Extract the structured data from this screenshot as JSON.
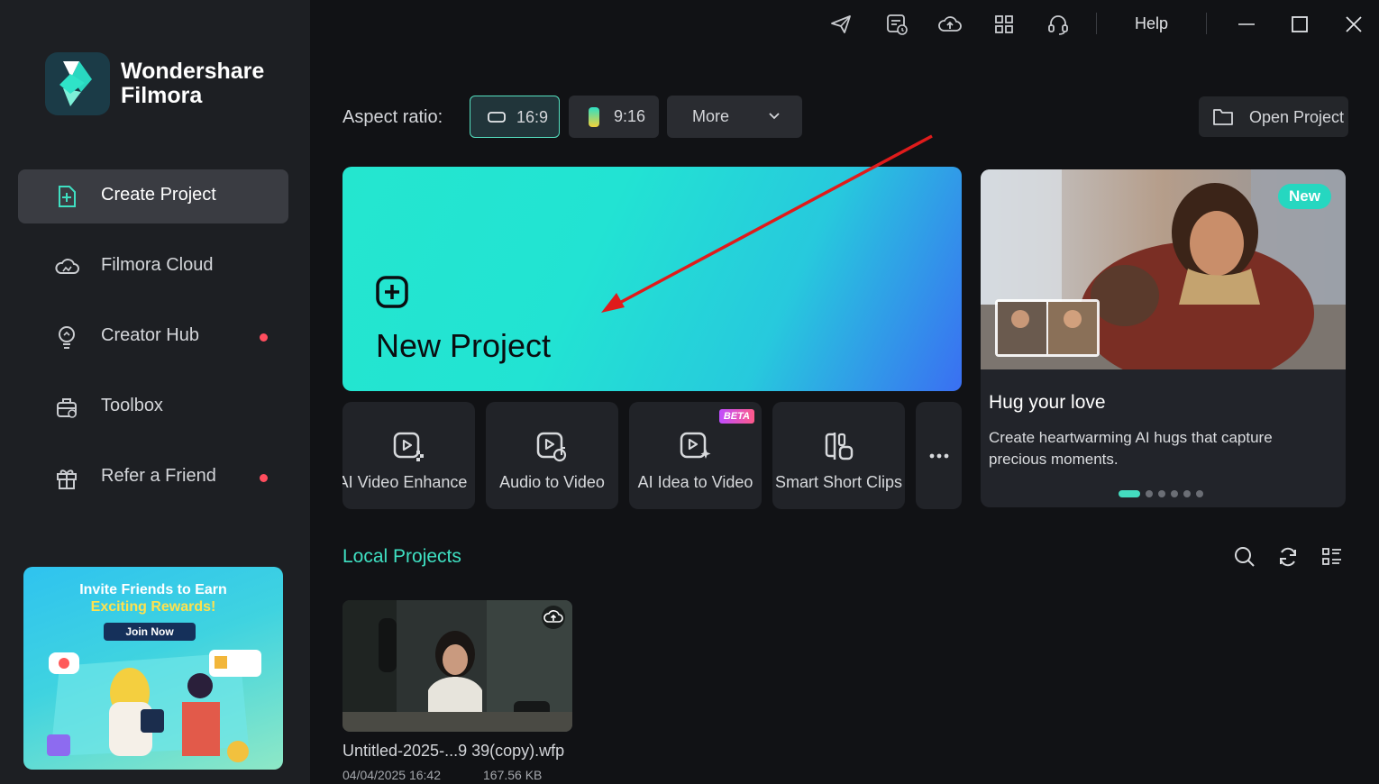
{
  "app": {
    "brand_line1": "Wondershare",
    "brand_line2": "Filmora"
  },
  "sidebar": {
    "items": [
      {
        "label": "Create Project",
        "icon": "plus-square-icon",
        "active": true
      },
      {
        "label": "Filmora Cloud",
        "icon": "cloud-icon"
      },
      {
        "label": "Creator Hub",
        "icon": "lightbulb-icon",
        "notification_dot": true
      },
      {
        "label": "Toolbox",
        "icon": "toolbox-icon"
      },
      {
        "label": "Refer a Friend",
        "icon": "gift-icon",
        "notification_dot": true
      }
    ],
    "promo": {
      "line1": "Invite Friends to Earn",
      "line2": "Exciting Rewards!",
      "button": "Join Now"
    }
  },
  "titlebar": {
    "icons": [
      "send-icon",
      "task-list-icon",
      "cloud-upload-icon",
      "apps-grid-icon",
      "headset-icon"
    ],
    "help": "Help",
    "window_controls": [
      "minimize-icon",
      "maximize-icon",
      "close-icon"
    ]
  },
  "aspect": {
    "label": "Aspect ratio:",
    "options": [
      {
        "label": "16:9",
        "selected": true
      },
      {
        "label": "9:16"
      }
    ],
    "more": "More"
  },
  "open_project": "Open Project",
  "new_project": "New Project",
  "tools": [
    {
      "label": "AI Video Enhance",
      "icon": "video-enhance-icon"
    },
    {
      "label": "Audio to Video",
      "icon": "audio-to-video-icon"
    },
    {
      "label": "AI Idea to Video",
      "icon": "idea-to-video-icon",
      "badge": "BETA"
    },
    {
      "label": "Smart Short Clips",
      "icon": "short-clips-icon"
    }
  ],
  "feature": {
    "badge": "New",
    "title": "Hug your love",
    "description": "Create heartwarming AI hugs that capture precious moments.",
    "slide_index": 1,
    "slide_count": 6
  },
  "local_projects": {
    "title": "Local Projects",
    "files": [
      {
        "name": "Untitled-2025-...9 39(copy).wfp",
        "date": "04/04/2025 16:42",
        "size": "167.56 KB"
      }
    ]
  },
  "colors": {
    "accent": "#3fe0c2",
    "notification": "#ff4d5e",
    "annotation_arrow": "#e01b1b"
  }
}
